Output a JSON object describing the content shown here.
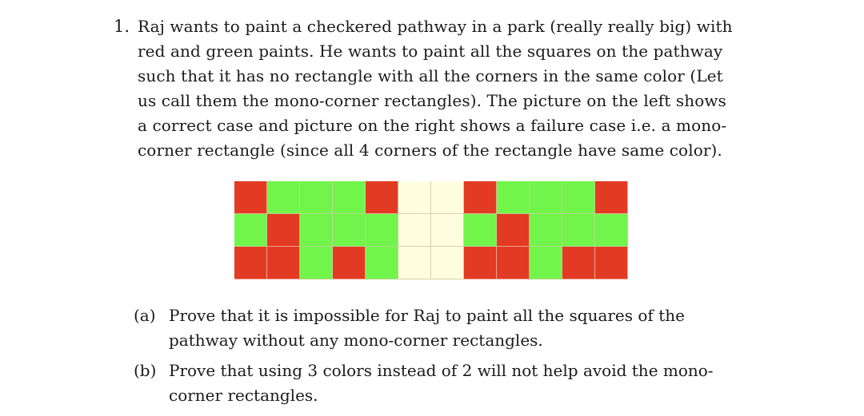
{
  "problem": {
    "number": "1.",
    "statement_lines": [
      "Raj wants to paint a checkered pathway in a park (really really big) with",
      "red and green paints.  He wants to paint all the squares on the pathway",
      "such that it has no rectangle with all the corners in the same color (Let",
      "us call them the mono-corner rectangles).  The picture on the left shows",
      "a correct case and picture on the right shows a failure case i.e.  a mono-",
      "corner rectangle (since all 4 corners of the rectangle have same color)."
    ]
  },
  "figure": {
    "description": "Two 5x3 checkered grids separated by a 2-column blank gap",
    "colors": {
      "R": "#e33a24",
      "G": "#72f54a",
      "Y": "#fffde0"
    },
    "legend": {
      "R": "red",
      "G": "green",
      "Y": "blank"
    },
    "rows": [
      [
        "R",
        "G",
        "G",
        "G",
        "R",
        "Y",
        "Y",
        "R",
        "G",
        "G",
        "G",
        "R"
      ],
      [
        "G",
        "R",
        "G",
        "G",
        "G",
        "Y",
        "Y",
        "G",
        "R",
        "G",
        "G",
        "G"
      ],
      [
        "R",
        "R",
        "G",
        "R",
        "G",
        "Y",
        "Y",
        "R",
        "R",
        "G",
        "R",
        "R"
      ]
    ]
  },
  "subparts": [
    {
      "label": "(a)",
      "lines": [
        "Prove that it is impossible for Raj to paint all the squares of the",
        "pathway without any mono-corner rectangles."
      ]
    },
    {
      "label": "(b)",
      "lines": [
        "Prove that using 3 colors instead of 2 will not help avoid the mono-",
        "corner rectangles."
      ]
    }
  ]
}
